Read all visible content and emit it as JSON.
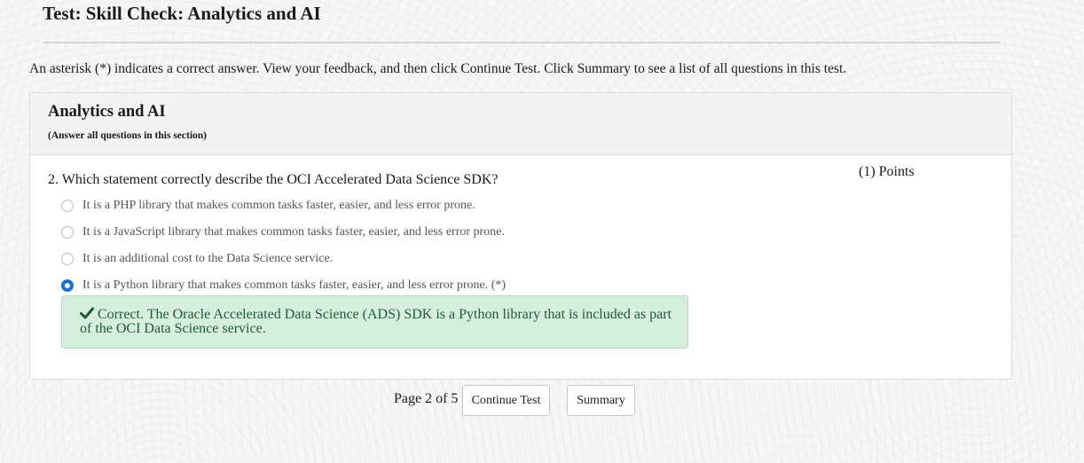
{
  "page": {
    "title": "Test: Skill Check: Analytics and AI",
    "instructions": "An asterisk (*) indicates a correct answer. View your feedback, and then click Continue Test. Click Summary to see a list of all questions in this test."
  },
  "section": {
    "title": "Analytics and AI",
    "note": "(Answer all questions in this section)"
  },
  "question": {
    "text": "2. Which statement correctly describe the OCI Accelerated Data Science SDK?",
    "points": "(1) Points",
    "options": [
      {
        "label": "It is a PHP library that makes common tasks faster, easier, and less error prone.",
        "selected": false
      },
      {
        "label": "It is a JavaScript library that makes common tasks faster, easier, and less error prone.",
        "selected": false
      },
      {
        "label": "It is an additional cost to the Data Science service.",
        "selected": false
      },
      {
        "label": "It is a Python library that makes common tasks faster, easier, and less error prone. (*)",
        "selected": true
      }
    ],
    "feedback": "Correct. The Oracle Accelerated Data Science (ADS) SDK is a Python library that is included as part of the OCI Data Science service.",
    "feedback_icon": "checkmark-icon"
  },
  "footer": {
    "pager": "Page 2 of 5",
    "continue_label": "Continue Test",
    "summary_label": "Summary"
  },
  "colors": {
    "accent": "#1a73c8",
    "feedback_bg": "#d5eedd",
    "feedback_text": "#1f5a30"
  }
}
